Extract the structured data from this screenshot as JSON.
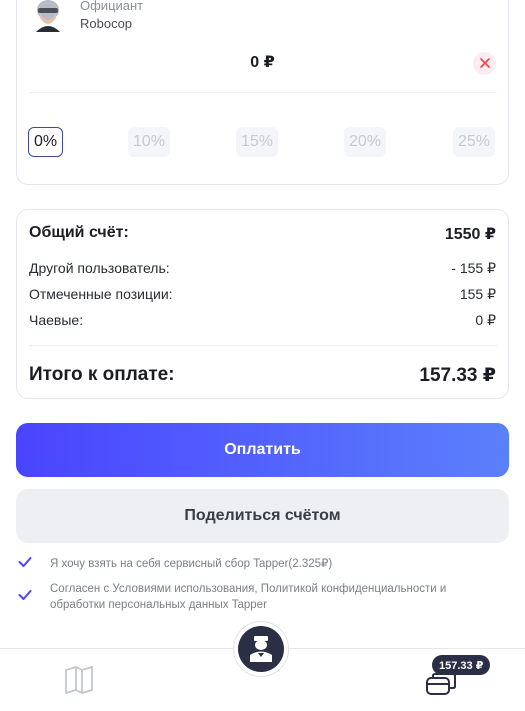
{
  "waiter": {
    "role": "Официант",
    "name": "Robocop",
    "avatar_icon": "robocop-avatar-icon"
  },
  "tips": {
    "amount": "0 ₽",
    "options": [
      "0%",
      "10%",
      "15%",
      "20%",
      "25%"
    ],
    "selected": "0%"
  },
  "summary": {
    "total_bill_label": "Общий счёт:",
    "total_bill_value": "1550 ₽",
    "other_user_label": "Другой пользователь:",
    "other_user_value": "- 155 ₽",
    "marked_items_label": "Отмеченные позиции:",
    "marked_items_value": "155 ₽",
    "tips_label": "Чаевые:",
    "tips_value": "0 ₽",
    "to_pay_label": "Итого к оплате:",
    "to_pay_value": "157.33 ₽"
  },
  "actions": {
    "pay_label": "Оплатить",
    "share_label": "Поделиться счётом"
  },
  "consents": {
    "service_fee": "Я хочу взять на себя сервисный сбор Tapper(2.325₽)",
    "terms_line1": "Согласен с Условиями использования, Политикой конфиденциальности и",
    "terms_line2": "обработки персональных данных Tapper"
  },
  "bottom_nav": {
    "cart_badge": "157.33 ₽",
    "menu_icon": "book-icon",
    "center_icon": "waiter-icon",
    "cart_icon": "wallet-icon"
  },
  "colors": {
    "accent": "#4a44ff",
    "dark": "#2a2f45",
    "clear": "#e5484d"
  }
}
